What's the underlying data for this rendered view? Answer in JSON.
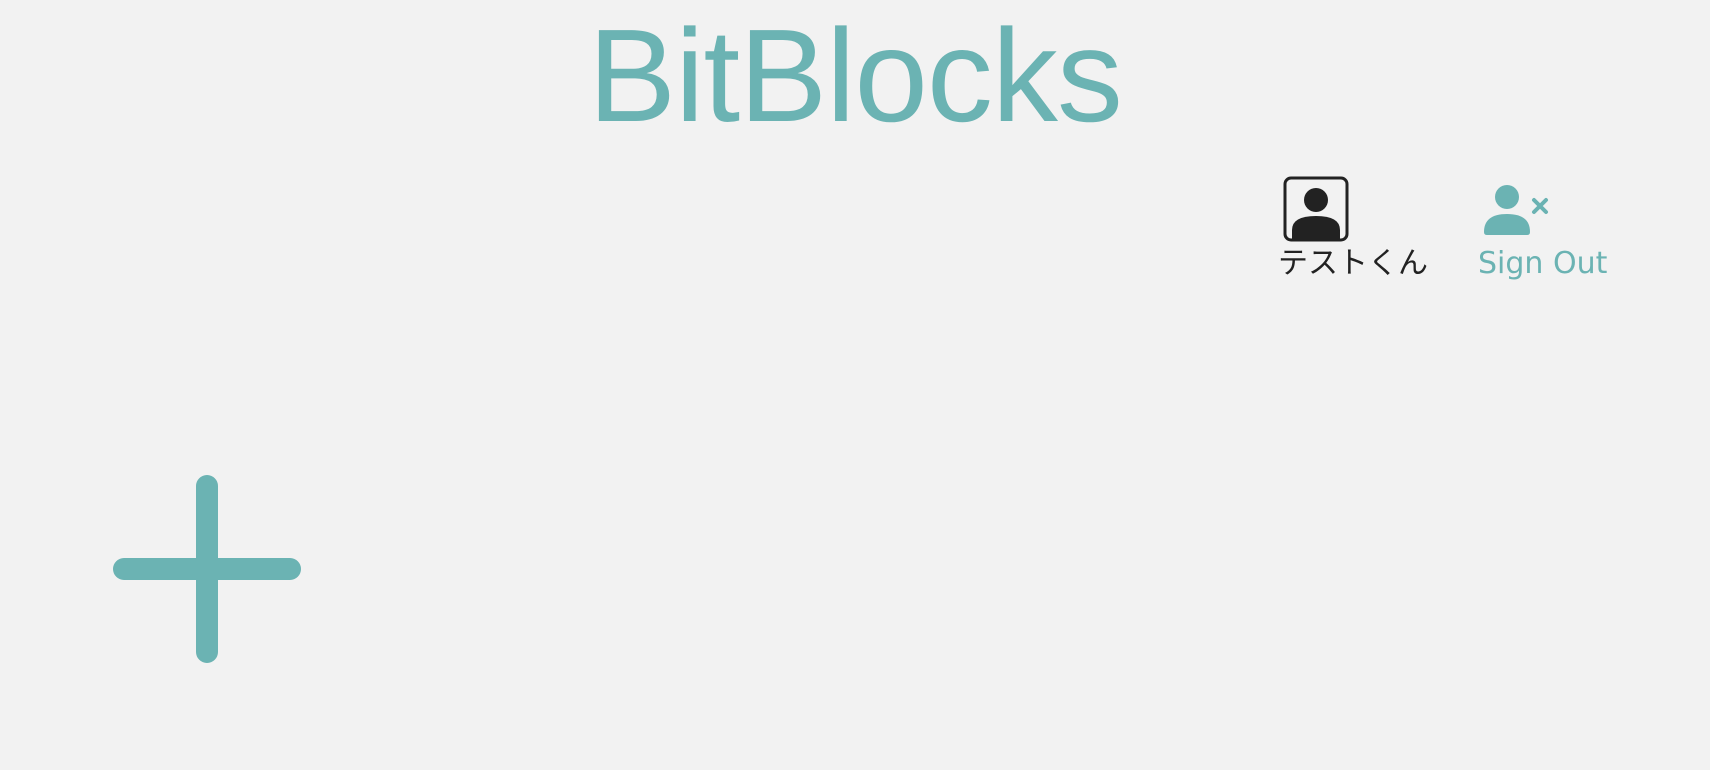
{
  "app": {
    "title": "BitBlocks"
  },
  "header": {
    "profile": {
      "avatar_icon": "person-square-icon",
      "name": "テストくん"
    },
    "signout": {
      "icon": "person-x-icon",
      "label": "Sign Out"
    }
  },
  "main": {
    "add_button": {
      "icon": "plus-icon"
    }
  },
  "colors": {
    "accent": "#6bb3b3",
    "text_dark": "#222222",
    "background": "#f2f2f2"
  }
}
